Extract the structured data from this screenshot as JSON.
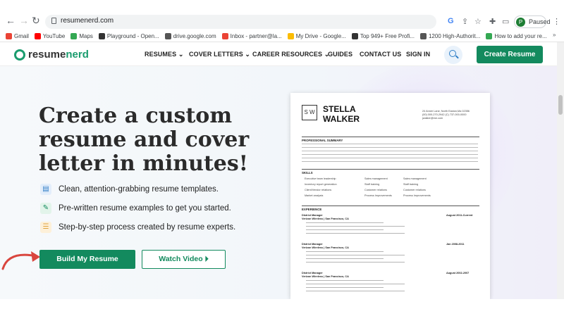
{
  "browser": {
    "url": "resumenerd.com",
    "profile_label": "Paused",
    "profile_initial": "P",
    "bookmarks": [
      {
        "label": "Gmail",
        "color": "#ea4335"
      },
      {
        "label": "YouTube",
        "color": "#ff0000"
      },
      {
        "label": "Maps",
        "color": "#34a853"
      },
      {
        "label": "Playground - Open...",
        "color": "#333333"
      },
      {
        "label": "drive.google.com",
        "color": "#555555"
      },
      {
        "label": "Inbox - partner@la...",
        "color": "#ea4335"
      },
      {
        "label": "My Drive - Google...",
        "color": "#fbbc04"
      },
      {
        "label": "Top 949+ Free Profi...",
        "color": "#333333"
      },
      {
        "label": "1200 High-Authorit...",
        "color": "#555555"
      },
      {
        "label": "How to add your re...",
        "color": "#34a853"
      }
    ]
  },
  "header": {
    "logo_text_a": "resume",
    "logo_text_b": "nerd",
    "nav": [
      "RESUMES",
      "COVER LETTERS",
      "CAREER RESOURCES",
      "GUIDES",
      "CONTACT US",
      "SIGN IN"
    ],
    "cta": "Create Resume"
  },
  "hero": {
    "title_line1": "Create a custom",
    "title_line2": "resume and cover",
    "title_line3": "letter in minutes!",
    "features": [
      "Clean, attention-grabbing resume templates.",
      "Pre-written resume examples to get you started.",
      "Step-by-step process created by resume experts."
    ],
    "primary_button": "Build My Resume",
    "secondary_button": "Watch Video"
  },
  "resume_preview": {
    "monogram": "S W",
    "first_name": "STELLA",
    "last_name": "WALKER",
    "contact_line1": "24 Anner Lane, North Easton,Ma 02356",
    "contact_line2": "(00) 000-270-2942 (C) 737-000-0000",
    "contact_line3": "jwalker@me.com",
    "section_summary": "PROFESSIONAL SUMMARY",
    "section_skills": "SKILLS",
    "skills": [
      "Executive team leadership",
      "Sales management",
      "Sales management",
      "Inventory report generation",
      "Staff training",
      "Staff training",
      "Client/Vendor relations",
      "Customer relations",
      "Customer relations",
      "Market analysis",
      "Process Improvements",
      "Process Improvements"
    ],
    "section_experience": "EXPERIENCE",
    "jobs": [
      {
        "title": "District Manager",
        "company": "Verizon Wireless | San Francisco, CA",
        "date": "August 2011-Current"
      },
      {
        "title": "District Manager",
        "company": "Verizon Wireless | San Francisco, CA",
        "date": "Jan 2008-2011"
      },
      {
        "title": "District Manager",
        "company": "Verizon Wireless | San Francisco, CA",
        "date": "August 2002-2007"
      }
    ]
  },
  "colors": {
    "brand_green": "#138a5e",
    "logo_green": "#1a9c6e",
    "arrow_red": "#d9463e"
  }
}
